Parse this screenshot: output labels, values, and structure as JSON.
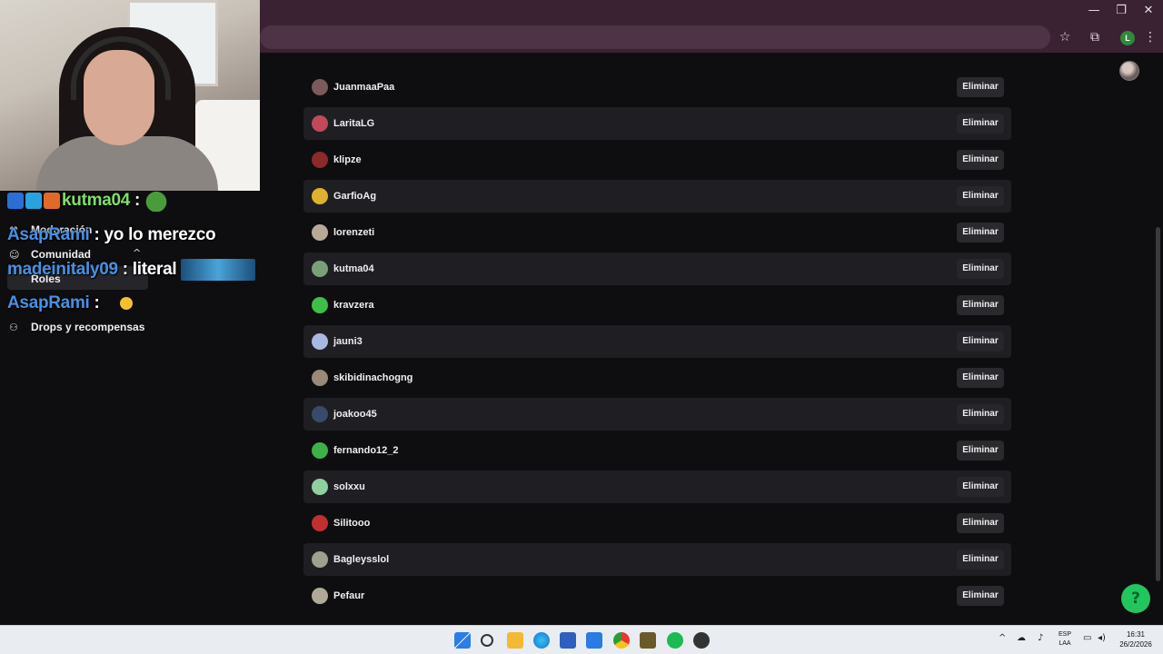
{
  "browser": {
    "window_controls": {
      "minimize": "—",
      "restore": "❐",
      "close": "✕"
    },
    "toolbar_icons": {
      "bookmark": "☆",
      "extensions": "⧉",
      "profile_initial": "L",
      "menu": "⋮"
    }
  },
  "sidebar": {
    "items": [
      {
        "label": "Moderación",
        "icon": "⚒"
      },
      {
        "label": "Comunidad",
        "icon": "☺"
      },
      {
        "label": "Roles",
        "icon": ""
      },
      {
        "label": "Drops y recompensas",
        "icon": "⚇"
      }
    ],
    "chevron": "^"
  },
  "chat_overlay": [
    {
      "user": "kutma04",
      "text": ":"
    },
    {
      "user": "AsapRami",
      "text": ": yo lo merezco"
    },
    {
      "user": "madeinitaly09",
      "text": ": literal"
    },
    {
      "user": "AsapRami",
      "text": ":"
    }
  ],
  "users": [
    {
      "name": "JuanmaaPaa",
      "action": "Eliminar",
      "avatar_color": "#7a5a5a"
    },
    {
      "name": "LaritaLG",
      "action": "Eliminar",
      "avatar_color": "#c04a5a"
    },
    {
      "name": "klipze",
      "action": "Eliminar",
      "avatar_color": "#8a2a2a"
    },
    {
      "name": "GarfioAg",
      "action": "Eliminar",
      "avatar_color": "#e0b030"
    },
    {
      "name": "lorenzeti",
      "action": "Eliminar",
      "avatar_color": "#b8a898"
    },
    {
      "name": "kutma04",
      "action": "Eliminar",
      "avatar_color": "#7aa07a"
    },
    {
      "name": "kravzera",
      "action": "Eliminar",
      "avatar_color": "#3fbf4a"
    },
    {
      "name": "jauni3",
      "action": "Eliminar",
      "avatar_color": "#a8b8e0"
    },
    {
      "name": "skibidinachogng",
      "action": "Eliminar",
      "avatar_color": "#9a8878"
    },
    {
      "name": "joakoo45",
      "action": "Eliminar",
      "avatar_color": "#3a4a6a"
    },
    {
      "name": "fernando12_2",
      "action": "Eliminar",
      "avatar_color": "#3fb04a"
    },
    {
      "name": "solxxu",
      "action": "Eliminar",
      "avatar_color": "#8fd0a0"
    },
    {
      "name": "Silitooo",
      "action": "Eliminar",
      "avatar_color": "#c03030"
    },
    {
      "name": "Bagleysslol",
      "action": "Eliminar",
      "avatar_color": "#a0a090"
    },
    {
      "name": "Pefaur",
      "action": "Eliminar",
      "avatar_color": "#b0a898"
    }
  ],
  "help_button_icon": "?",
  "taskbar": {
    "lang_top": "ESP",
    "lang_bottom": "LAA",
    "time": "16:31",
    "date": "26/2/2026"
  }
}
